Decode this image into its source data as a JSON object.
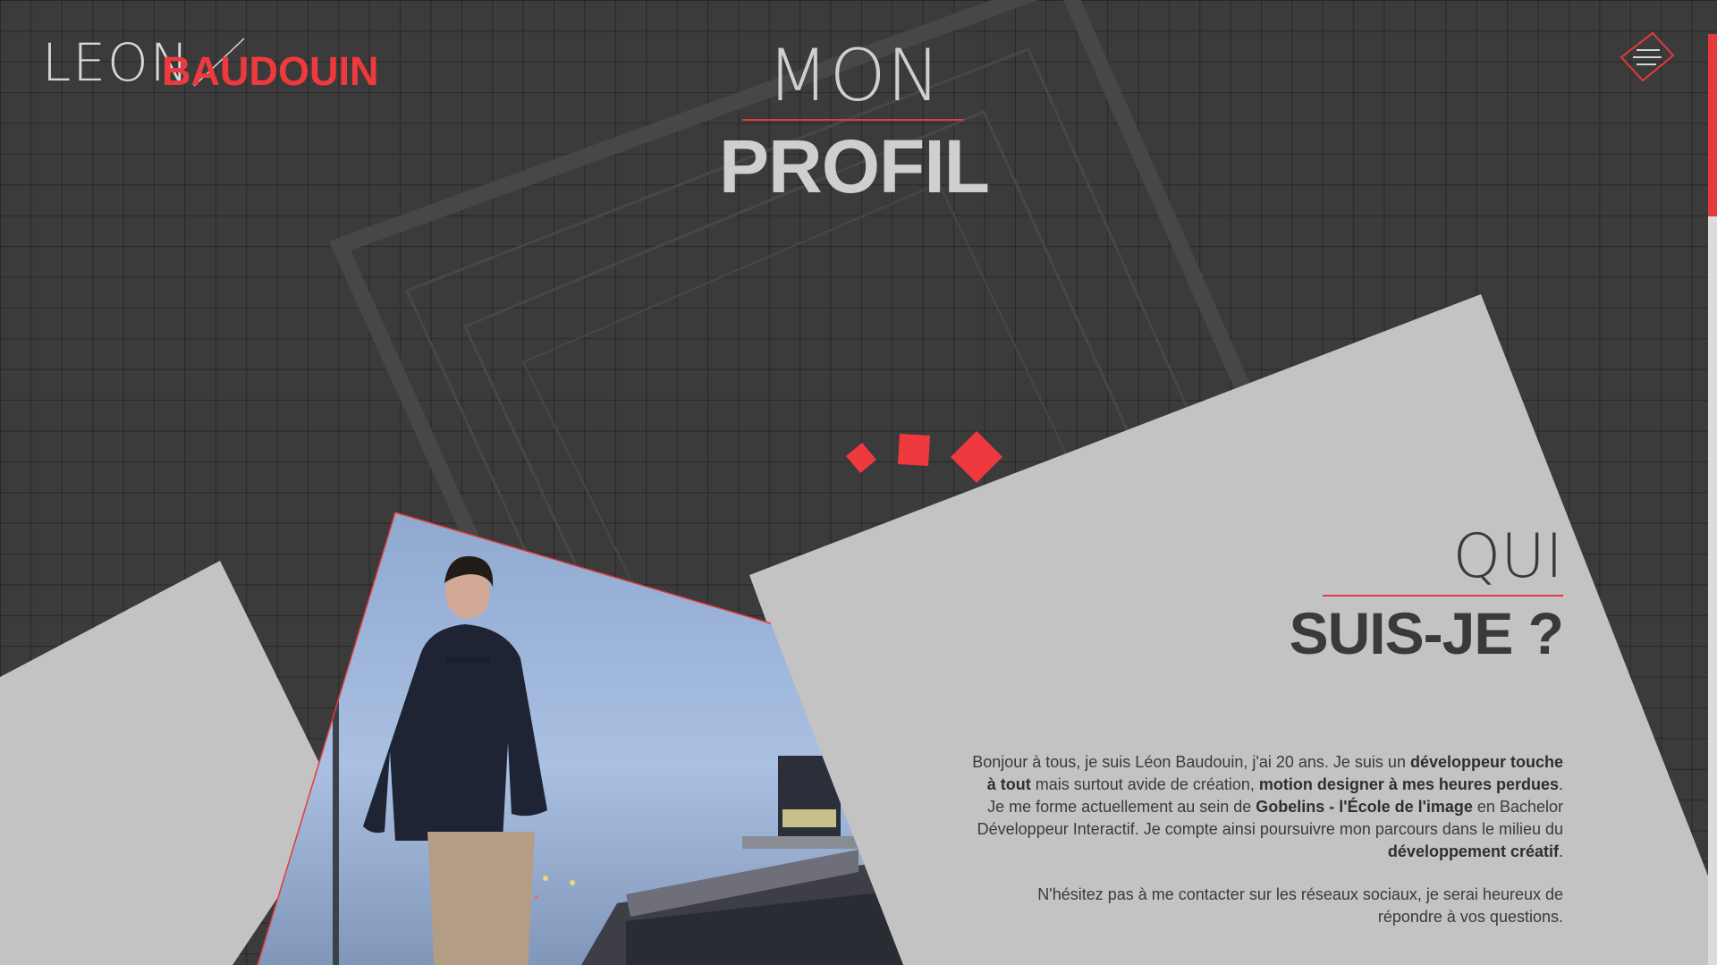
{
  "brand": {
    "first_name": "LEON",
    "last_name": "BAUDOUIN"
  },
  "hero": {
    "title_top": "MON",
    "title_main": "PROFIL"
  },
  "menu": {
    "icon": "hamburger-diamond-icon"
  },
  "about": {
    "heading_top": "QUI",
    "heading_main": "SUIS-JE ?",
    "bio_p1": [
      {
        "t": "Bonjour à tous, je suis Léon Baudouin, j'ai 20 ans. Je suis un ",
        "b": false
      },
      {
        "t": "développeur touche à tout",
        "b": true
      },
      {
        "t": " mais surtout avide de création, ",
        "b": false
      },
      {
        "t": "motion designer à mes heures perdues",
        "b": true
      },
      {
        "t": ". Je me forme actuellement au sein de ",
        "b": false
      },
      {
        "t": "Gobelins - l'École de l'image",
        "b": true
      },
      {
        "t": " en Bachelor Développeur Interactif. Je compte ainsi poursuivre mon parcours dans le milieu du ",
        "b": false
      },
      {
        "t": "développement créatif",
        "b": true
      },
      {
        "t": ".",
        "b": false
      }
    ],
    "bio_p2": "N'hésitez pas à me contacter sur les réseaux sociaux, je serai heureux de répondre à vos questions."
  },
  "colors": {
    "accent": "#e6393c",
    "background": "#3b3b3b",
    "panel": "#c4c3c4",
    "text_dark": "#3a3a3a",
    "text_light": "#cfcfcf"
  }
}
